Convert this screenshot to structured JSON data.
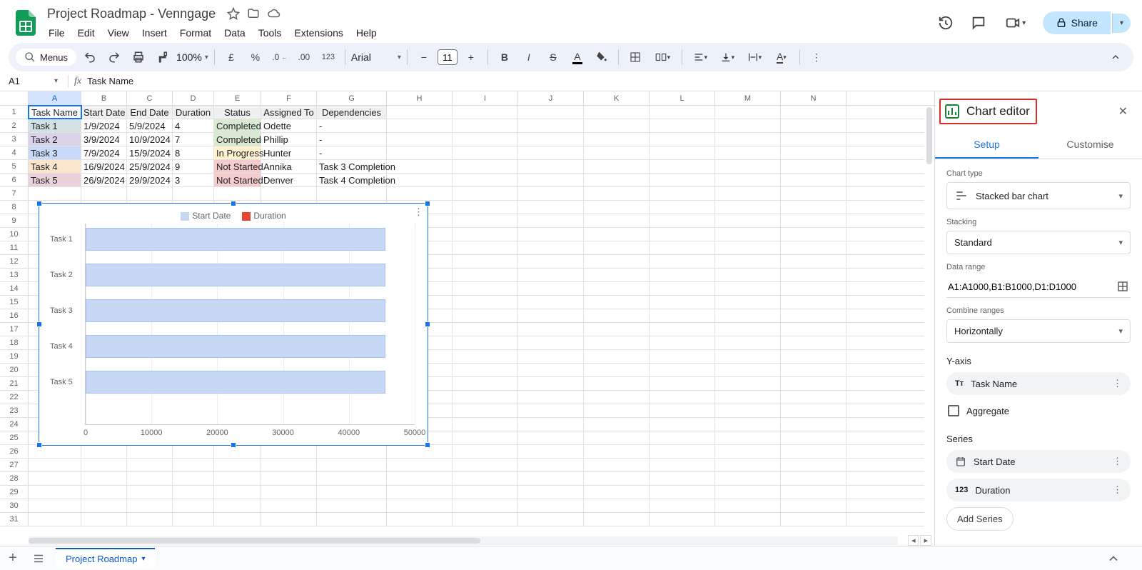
{
  "doc": {
    "title": "Project Roadmap - Venngage"
  },
  "menus": [
    "File",
    "Edit",
    "View",
    "Insert",
    "Format",
    "Data",
    "Tools",
    "Extensions",
    "Help"
  ],
  "share": {
    "label": "Share"
  },
  "toolbar": {
    "search_placeholder": "Menus",
    "zoom": "100%",
    "font": "Arial",
    "fontsize": "11"
  },
  "namebox": "A1",
  "formula": "Task Name",
  "columns": [
    "A",
    "B",
    "C",
    "D",
    "E",
    "F",
    "G",
    "H",
    "I",
    "J",
    "K",
    "L",
    "M",
    "N"
  ],
  "headers": [
    "Task Name",
    "Start Date",
    "End Date",
    "Duration",
    "Status",
    "Assigned To",
    "Dependencies"
  ],
  "tasks": [
    {
      "name": "Task 1",
      "start": "1/9/2024",
      "end": "5/9/2024",
      "dur": "4",
      "status": "Completed",
      "statusCls": "status-completed",
      "assignee": "Odette",
      "dep": "-",
      "cls": "task-1"
    },
    {
      "name": "Task 2",
      "start": "3/9/2024",
      "end": "10/9/2024",
      "dur": "7",
      "status": "Completed",
      "statusCls": "status-completed",
      "assignee": "Phillip",
      "dep": "-",
      "cls": "task-2"
    },
    {
      "name": "Task 3",
      "start": "7/9/2024",
      "end": "15/9/2024",
      "dur": "8",
      "status": "In Progress",
      "statusCls": "status-progress",
      "assignee": "Hunter",
      "dep": "-",
      "cls": "task-3"
    },
    {
      "name": "Task 4",
      "start": "16/9/2024",
      "end": "25/9/2024",
      "dur": "9",
      "status": "Not Started",
      "statusCls": "status-notstarted",
      "assignee": "Annika",
      "dep": "Task 3 Completion",
      "cls": "task-4"
    },
    {
      "name": "Task 5",
      "start": "26/9/2024",
      "end": "29/9/2024",
      "dur": "3",
      "status": "Not Started",
      "statusCls": "status-notstarted",
      "assignee": "Denver",
      "dep": "Task 4 Completion",
      "cls": "task-5"
    }
  ],
  "chart_data": {
    "type": "bar",
    "orientation": "horizontal",
    "stacked": true,
    "categories": [
      "Task 1",
      "Task 2",
      "Task 3",
      "Task 4",
      "Task 5"
    ],
    "series": [
      {
        "name": "Start Date",
        "values": [
          45536,
          45538,
          45542,
          45551,
          45561
        ],
        "color": "#c7d8f4"
      },
      {
        "name": "Duration",
        "values": [
          4,
          7,
          8,
          9,
          3
        ],
        "color": "#ea4335"
      }
    ],
    "x_ticks": [
      0,
      10000,
      20000,
      30000,
      40000,
      50000
    ],
    "xlim": [
      0,
      50000
    ],
    "legend": [
      "Start Date",
      "Duration"
    ]
  },
  "sidebar": {
    "title": "Chart editor",
    "tabs": {
      "setup": "Setup",
      "customise": "Customise"
    },
    "chart_type_label": "Chart type",
    "chart_type_value": "Stacked bar chart",
    "stacking_label": "Stacking",
    "stacking_value": "Standard",
    "data_range_label": "Data range",
    "data_range_value": "A1:A1000,B1:B1000,D1:D1000",
    "combine_label": "Combine ranges",
    "combine_value": "Horizontally",
    "yaxis_title": "Y-axis",
    "yaxis_value": "Task Name",
    "aggregate_label": "Aggregate",
    "series_title": "Series",
    "series_values": [
      "Start Date",
      "Duration"
    ],
    "add_series": "Add Series"
  },
  "sheet_tab": "Project Roadmap"
}
